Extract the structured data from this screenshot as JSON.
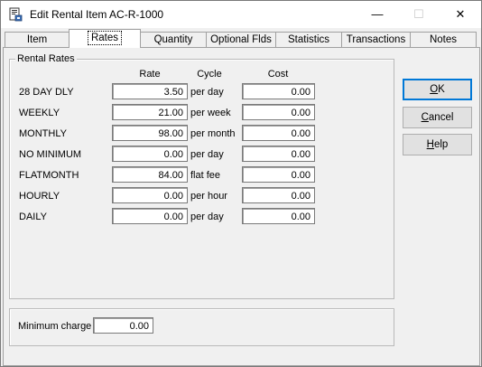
{
  "window": {
    "title": "Edit Rental Item AC-R-1000",
    "minimize_glyph": "—",
    "maximize_glyph": "☐",
    "close_glyph": "✕"
  },
  "tabs": [
    {
      "label": "Item"
    },
    {
      "label": "Rates"
    },
    {
      "label": "Quantity"
    },
    {
      "label": "Optional Flds"
    },
    {
      "label": "Statistics"
    },
    {
      "label": "Transactions"
    },
    {
      "label": "Notes"
    }
  ],
  "rental_rates": {
    "group_label": "Rental Rates",
    "headers": {
      "rate": "Rate",
      "cycle": "Cycle",
      "cost": "Cost"
    },
    "rows": [
      {
        "name": "28 DAY DLY",
        "rate": "3.50",
        "cycle": "per day",
        "cost": "0.00"
      },
      {
        "name": "WEEKLY",
        "rate": "21.00",
        "cycle": "per week",
        "cost": "0.00"
      },
      {
        "name": "MONTHLY",
        "rate": "98.00",
        "cycle": "per month",
        "cost": "0.00"
      },
      {
        "name": "NO MINIMUM",
        "rate": "0.00",
        "cycle": "per day",
        "cost": "0.00"
      },
      {
        "name": "FLATMONTH",
        "rate": "84.00",
        "cycle": "flat fee",
        "cost": "0.00"
      },
      {
        "name": "HOURLY",
        "rate": "0.00",
        "cycle": "per hour",
        "cost": "0.00"
      },
      {
        "name": "DAILY",
        "rate": "0.00",
        "cycle": "per day",
        "cost": "0.00"
      }
    ]
  },
  "minimum_charge": {
    "label": "Minimum charge",
    "value": "0.00"
  },
  "buttons": {
    "ok": {
      "mnemonic": "O",
      "rest": "K"
    },
    "cancel": {
      "mnemonic": "C",
      "rest": "ancel"
    },
    "help": {
      "mnemonic": "H",
      "rest": "elp"
    }
  }
}
